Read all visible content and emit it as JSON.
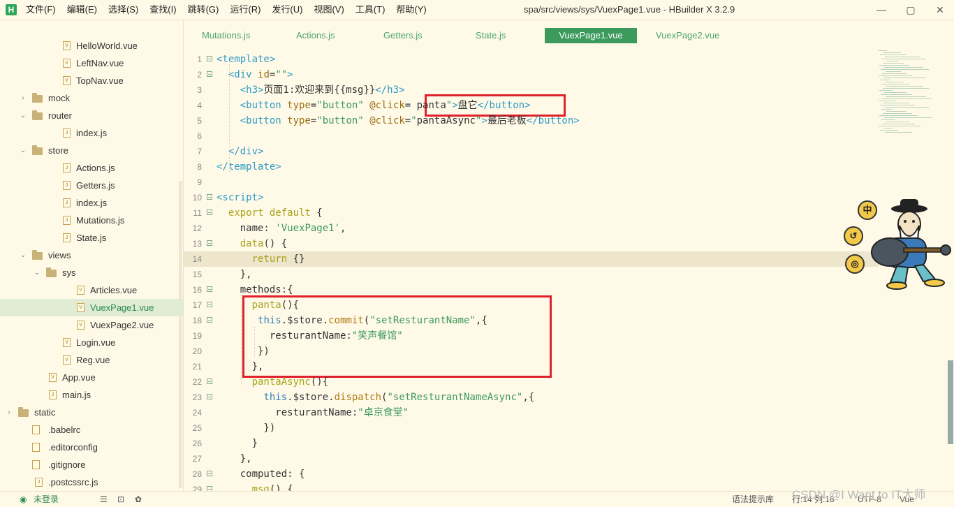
{
  "app": {
    "logo": "H",
    "title": "spa/src/views/sys/VuexPage1.vue - HBuilder X 3.2.9"
  },
  "menu": [
    "文件(F)",
    "编辑(E)",
    "选择(S)",
    "查找(I)",
    "跳转(G)",
    "运行(R)",
    "发行(U)",
    "视图(V)",
    "工具(T)",
    "帮助(Y)"
  ],
  "window_controls": {
    "minimize": "—",
    "maximize": "▢",
    "close": "✕"
  },
  "tree": [
    {
      "label": "HelloWorld.vue",
      "type": "file",
      "icon": "V"
    },
    {
      "label": "LeftNav.vue",
      "type": "file",
      "icon": "V"
    },
    {
      "label": "TopNav.vue",
      "type": "file",
      "icon": "V"
    },
    {
      "label": "mock",
      "type": "folder",
      "chev": "›"
    },
    {
      "label": "router",
      "type": "folder",
      "chev": "⌄"
    },
    {
      "label": "index.js",
      "type": "file",
      "icon": "J"
    },
    {
      "label": "store",
      "type": "folder",
      "chev": "⌄"
    },
    {
      "label": "Actions.js",
      "type": "file",
      "icon": "J"
    },
    {
      "label": "Getters.js",
      "type": "file",
      "icon": "J"
    },
    {
      "label": "index.js",
      "type": "file",
      "icon": "J"
    },
    {
      "label": "Mutations.js",
      "type": "file",
      "icon": "J"
    },
    {
      "label": "State.js",
      "type": "file",
      "icon": "J"
    },
    {
      "label": "views",
      "type": "folder",
      "chev": "⌄"
    },
    {
      "label": "sys",
      "type": "folder",
      "chev": "⌄"
    },
    {
      "label": "Articles.vue",
      "type": "file",
      "icon": "V"
    },
    {
      "label": "VuexPage1.vue",
      "type": "file",
      "icon": "V",
      "selected": true
    },
    {
      "label": "VuexPage2.vue",
      "type": "file",
      "icon": "V"
    },
    {
      "label": "Login.vue",
      "type": "file",
      "icon": "V"
    },
    {
      "label": "Reg.vue",
      "type": "file",
      "icon": "V"
    },
    {
      "label": "App.vue",
      "type": "file",
      "icon": "V"
    },
    {
      "label": "main.js",
      "type": "file",
      "icon": "J"
    },
    {
      "label": "static",
      "type": "folder",
      "chev": "›"
    },
    {
      "label": ".babelrc",
      "type": "plain"
    },
    {
      "label": ".editorconfig",
      "type": "plain"
    },
    {
      "label": ".gitignore",
      "type": "plain"
    },
    {
      "label": ".postcssrc.js",
      "type": "file",
      "icon": "J"
    }
  ],
  "tabs": [
    "Mutations.js",
    "Actions.js",
    "Getters.js",
    "State.js",
    "VuexPage1.vue",
    "VuexPage2.vue"
  ],
  "active_tab": "VuexPage1.vue",
  "code_lines": [
    {
      "n": "1",
      "fold": "⊟",
      "tokens": [
        [
          "tag",
          "<template>"
        ]
      ]
    },
    {
      "n": "2",
      "fold": "⊟",
      "tokens": [
        [
          "txt",
          "  "
        ],
        [
          "tag",
          "<div "
        ],
        [
          "attr",
          "id"
        ],
        [
          "txt",
          "="
        ],
        [
          "str",
          "\"\""
        ],
        [
          "tag",
          ">"
        ]
      ]
    },
    {
      "n": "3",
      "tokens": [
        [
          "txt",
          "    "
        ],
        [
          "tag",
          "<h3>"
        ],
        [
          "txt",
          "页面1:欢迎来到{{msg}}"
        ],
        [
          "tag",
          "</h3>"
        ]
      ]
    },
    {
      "n": "4",
      "tokens": [
        [
          "txt",
          "    "
        ],
        [
          "tag",
          "<button "
        ],
        [
          "attr",
          "type"
        ],
        [
          "txt",
          "="
        ],
        [
          "str",
          "\"button\""
        ],
        [
          "txt",
          " "
        ],
        [
          "attr",
          "@click"
        ],
        [
          "txt",
          "= "
        ],
        [
          "txt",
          "panta"
        ],
        [
          "str",
          "\""
        ],
        [
          "tag",
          ">"
        ],
        [
          "txt",
          "盘它"
        ],
        [
          "tag",
          "</button>"
        ]
      ]
    },
    {
      "n": "5",
      "tokens": [
        [
          "txt",
          "    "
        ],
        [
          "tag",
          "<button "
        ],
        [
          "attr",
          "type"
        ],
        [
          "txt",
          "="
        ],
        [
          "str",
          "\"button\""
        ],
        [
          "txt",
          " "
        ],
        [
          "attr",
          "@click"
        ],
        [
          "txt",
          "="
        ],
        [
          "str",
          "\""
        ],
        [
          "txt",
          "pantaAsync"
        ],
        [
          "str",
          "\""
        ],
        [
          "tag",
          ">"
        ],
        [
          "txt",
          "最后老板"
        ],
        [
          "tag",
          "</button>"
        ]
      ]
    },
    {
      "n": "6",
      "tokens": []
    },
    {
      "n": "7",
      "tokens": [
        [
          "txt",
          "  "
        ],
        [
          "tag",
          "</div>"
        ]
      ]
    },
    {
      "n": "8",
      "tokens": [
        [
          "tag",
          "</template>"
        ]
      ]
    },
    {
      "n": "9",
      "tokens": []
    },
    {
      "n": "10",
      "fold": "⊟",
      "tokens": [
        [
          "tag",
          "<script>"
        ]
      ]
    },
    {
      "n": "11",
      "fold": "⊟",
      "tokens": [
        [
          "txt",
          "  "
        ],
        [
          "kw",
          "export default"
        ],
        [
          "txt",
          " {"
        ]
      ]
    },
    {
      "n": "12",
      "tokens": [
        [
          "txt",
          "    name: "
        ],
        [
          "str",
          "'VuexPage1'"
        ],
        [
          "txt",
          ","
        ]
      ]
    },
    {
      "n": "13",
      "fold": "⊟",
      "tokens": [
        [
          "txt",
          "    "
        ],
        [
          "kw",
          "data"
        ],
        [
          "txt",
          "() {"
        ]
      ]
    },
    {
      "n": "14",
      "current": true,
      "tokens": [
        [
          "txt",
          "      "
        ],
        [
          "kw",
          "return"
        ],
        [
          "txt",
          " {}"
        ]
      ]
    },
    {
      "n": "15",
      "tokens": [
        [
          "txt",
          "    },"
        ]
      ]
    },
    {
      "n": "16",
      "fold": "⊟",
      "tokens": [
        [
          "txt",
          "    methods:{"
        ]
      ]
    },
    {
      "n": "17",
      "fold": "⊟",
      "tokens": [
        [
          "txt",
          "      "
        ],
        [
          "kw",
          "panta"
        ],
        [
          "txt",
          "(){"
        ]
      ]
    },
    {
      "n": "18",
      "fold": "⊟",
      "tokens": [
        [
          "txt",
          "       "
        ],
        [
          "this",
          "this"
        ],
        [
          "txt",
          ".$store."
        ],
        [
          "fn",
          "commit"
        ],
        [
          "txt",
          "("
        ],
        [
          "str",
          "\"setResturantName\""
        ],
        [
          "txt",
          ",{"
        ]
      ]
    },
    {
      "n": "19",
      "tokens": [
        [
          "txt",
          "         resturantName:"
        ],
        [
          "str",
          "\"笑声餐馆\""
        ]
      ]
    },
    {
      "n": "20",
      "tokens": [
        [
          "txt",
          "       })"
        ]
      ]
    },
    {
      "n": "21",
      "tokens": [
        [
          "txt",
          "      },"
        ]
      ]
    },
    {
      "n": "22",
      "fold": "⊟",
      "tokens": [
        [
          "txt",
          "      "
        ],
        [
          "kw",
          "pantaAsync"
        ],
        [
          "txt",
          "(){"
        ]
      ]
    },
    {
      "n": "23",
      "fold": "⊟",
      "tokens": [
        [
          "txt",
          "        "
        ],
        [
          "this",
          "this"
        ],
        [
          "txt",
          ".$store."
        ],
        [
          "fn",
          "dispatch"
        ],
        [
          "txt",
          "("
        ],
        [
          "str",
          "\"setResturantNameAsync\""
        ],
        [
          "txt",
          ",{"
        ]
      ]
    },
    {
      "n": "24",
      "tokens": [
        [
          "txt",
          "          resturantName:"
        ],
        [
          "str",
          "\"卓京食堂\""
        ]
      ]
    },
    {
      "n": "25",
      "tokens": [
        [
          "txt",
          "        })"
        ]
      ]
    },
    {
      "n": "26",
      "tokens": [
        [
          "txt",
          "      }"
        ]
      ]
    },
    {
      "n": "27",
      "tokens": [
        [
          "txt",
          "    },"
        ]
      ]
    },
    {
      "n": "28",
      "fold": "⊟",
      "tokens": [
        [
          "txt",
          "    computed: {"
        ]
      ]
    },
    {
      "n": "29",
      "fold": "⊟",
      "tokens": [
        [
          "txt",
          "      "
        ],
        [
          "kw",
          "msg"
        ],
        [
          "txt",
          "() {"
        ]
      ]
    }
  ],
  "mascot": {
    "btn1": "中",
    "btn2": "↺",
    "btn3": "◎"
  },
  "status": {
    "login": "未登录",
    "hint": "语法提示库",
    "position": "行:14  列:16",
    "encoding": "UTF-8",
    "lang": "Vue"
  },
  "watermark": "CSDN @I Want to IT大师"
}
